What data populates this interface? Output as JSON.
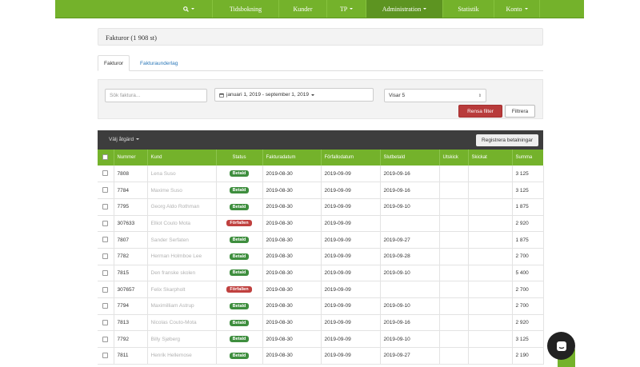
{
  "nav": {
    "search_icon": "search-icon",
    "items": [
      {
        "label": "Tidsbokning",
        "dropdown": false,
        "active": false
      },
      {
        "label": "Kunder",
        "dropdown": false,
        "active": false
      },
      {
        "label": "TP",
        "dropdown": true,
        "active": false
      },
      {
        "label": "Administration",
        "dropdown": true,
        "active": true
      },
      {
        "label": "Statistik",
        "dropdown": false,
        "active": false
      },
      {
        "label": "Konto",
        "dropdown": true,
        "active": false
      }
    ]
  },
  "page": {
    "title": "Fakturor (1 908 st)"
  },
  "tabs": [
    {
      "label": "Fakturor"
    },
    {
      "label": "Fakturaunderlag"
    }
  ],
  "filters": {
    "search_placeholder": "Sök faktura...",
    "date_range": "januari 1, 2019 - september 1, 2019",
    "show_select": "Visar 5",
    "reset_button": "Rensa filter",
    "filter_button": "Filtrera"
  },
  "actions": {
    "choose_action": "Välj åtgärd",
    "register_payments": "Registrera betalningar"
  },
  "table": {
    "columns": [
      "Nummer",
      "Kund",
      "Status",
      "Fakturadatum",
      "Förfallodatum",
      "Slutbetald",
      "Utskick",
      "Skickat",
      "Summa"
    ],
    "rows": [
      {
        "number": "7808",
        "customer": "Lena Suso",
        "status": "Betald",
        "status_type": "paid",
        "invoice_date": "2019-08-30",
        "due_date": "2019-09-09",
        "paid_date": "2019-09-16",
        "sum": "3 125"
      },
      {
        "number": "7784",
        "customer": "Maxime Suso",
        "status": "Betald",
        "status_type": "paid",
        "invoice_date": "2019-08-30",
        "due_date": "2019-09-09",
        "paid_date": "2019-09-16",
        "sum": "3 125"
      },
      {
        "number": "7795",
        "customer": "Georg Aldo Rothman",
        "status": "Betald",
        "status_type": "paid",
        "invoice_date": "2019-08-30",
        "due_date": "2019-09-09",
        "paid_date": "2019-09-10",
        "sum": "1 875"
      },
      {
        "number": "307633",
        "customer": "Elliot Couto Mota",
        "status": "Förfallen",
        "status_type": "overdue",
        "invoice_date": "2019-08-30",
        "due_date": "2019-09-09",
        "paid_date": "",
        "sum": "2 920"
      },
      {
        "number": "7807",
        "customer": "Sander Serfaten",
        "status": "Betald",
        "status_type": "paid",
        "invoice_date": "2019-08-30",
        "due_date": "2019-09-09",
        "paid_date": "2019-09-27",
        "sum": "1 875"
      },
      {
        "number": "7782",
        "customer": "Herman Holmboe Lee",
        "status": "Betald",
        "status_type": "paid",
        "invoice_date": "2019-08-30",
        "due_date": "2019-09-09",
        "paid_date": "2019-09-28",
        "sum": "2 700"
      },
      {
        "number": "7815",
        "customer": "Den franske skolen",
        "status": "Betald",
        "status_type": "paid",
        "invoice_date": "2019-08-30",
        "due_date": "2019-09-09",
        "paid_date": "2019-09-10",
        "sum": "5 400"
      },
      {
        "number": "307657",
        "customer": "Felix Skarpholt",
        "status": "Förfallen",
        "status_type": "overdue",
        "invoice_date": "2019-08-30",
        "due_date": "2019-09-09",
        "paid_date": "",
        "sum": "2 700"
      },
      {
        "number": "7794",
        "customer": "Maximilliam Astrup",
        "status": "Betald",
        "status_type": "paid",
        "invoice_date": "2019-08-30",
        "due_date": "2019-09-09",
        "paid_date": "2019-09-10",
        "sum": "2 700"
      },
      {
        "number": "7813",
        "customer": "Nicolas Couto-Mota",
        "status": "Betald",
        "status_type": "paid",
        "invoice_date": "2019-08-30",
        "due_date": "2019-09-09",
        "paid_date": "2019-09-16",
        "sum": "2 920"
      },
      {
        "number": "7792",
        "customer": "Billy Sjøberg",
        "status": "Betald",
        "status_type": "paid",
        "invoice_date": "2019-08-30",
        "due_date": "2019-09-09",
        "paid_date": "2019-09-10",
        "sum": "3 125"
      },
      {
        "number": "7811",
        "customer": "Henrik Hellemose",
        "status": "Betald",
        "status_type": "paid",
        "invoice_date": "2019-08-30",
        "due_date": "2019-09-09",
        "paid_date": "2019-09-27",
        "sum": "2 190"
      }
    ]
  },
  "colors": {
    "brand_green": "#74b22b",
    "paid": "#3e8e3e",
    "overdue": "#c0413f"
  }
}
